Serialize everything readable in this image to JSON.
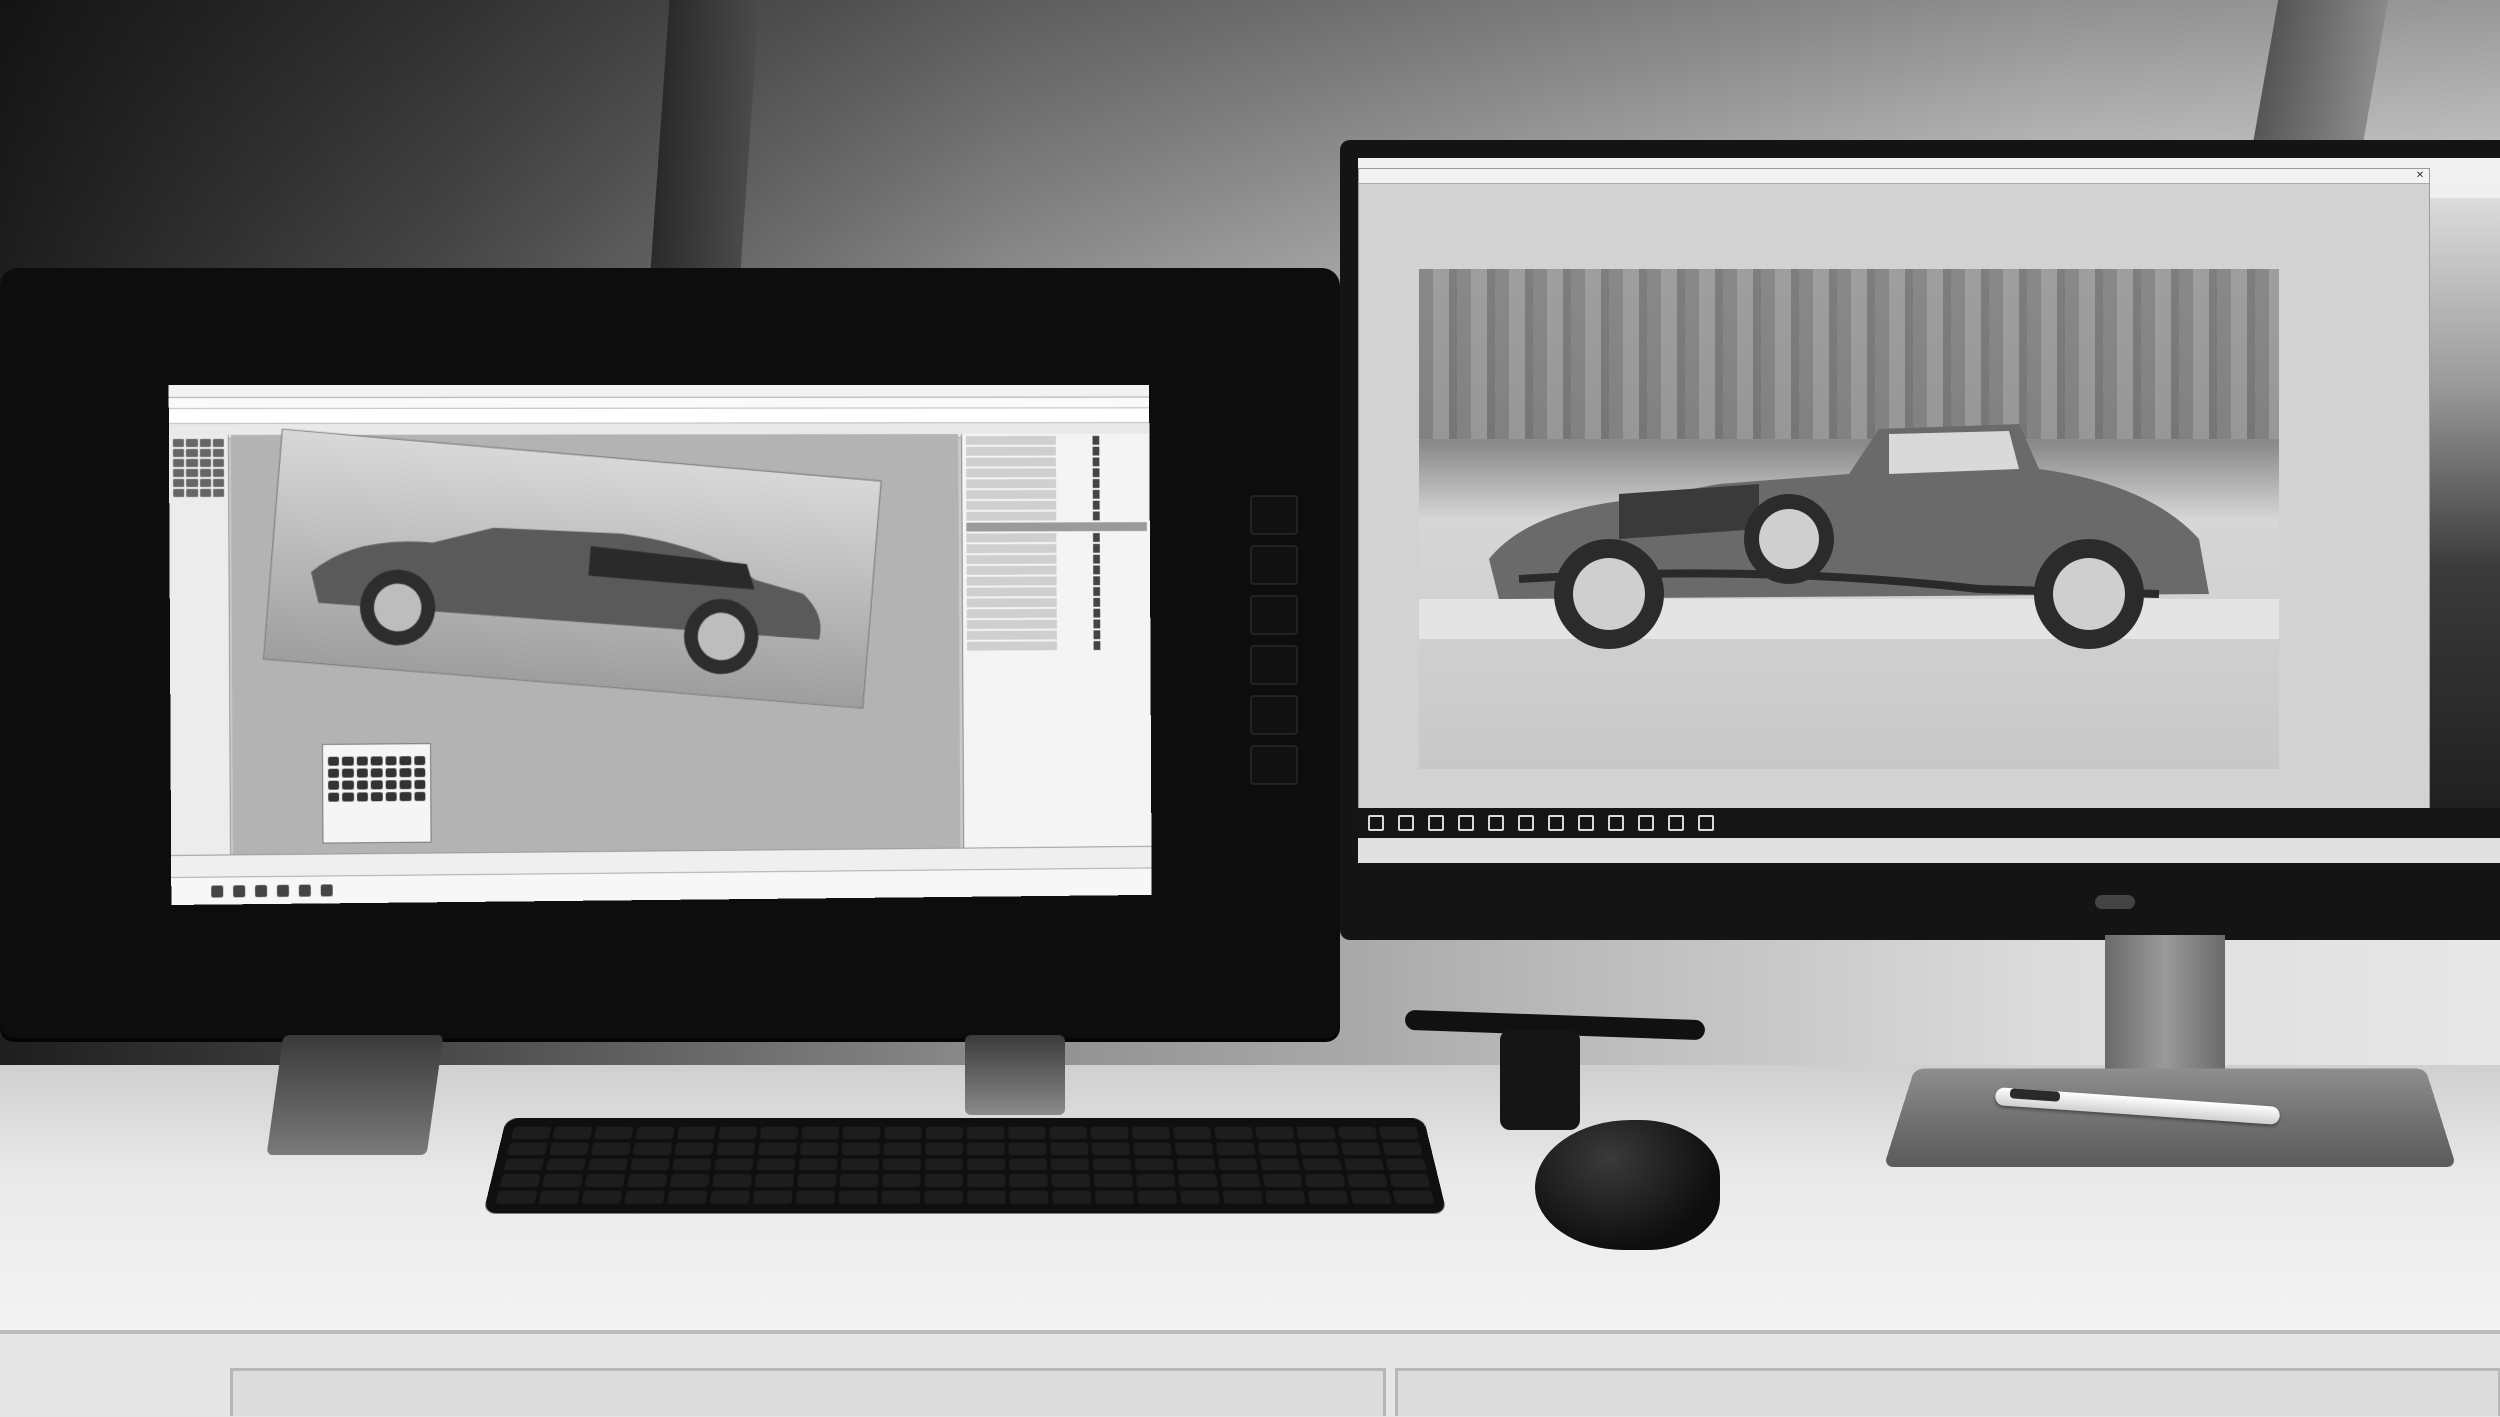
{
  "scene": {
    "palette": {
      "wall": "#b9b9b9",
      "desk": "#f0f0f0",
      "device_body": "#0d0d0d",
      "screen": "#d2d2d2"
    }
  },
  "objects": [
    {
      "name": "pen-display-tablet",
      "icon": "pen-display-icon"
    },
    {
      "name": "cad-application",
      "icon": "window-icon"
    },
    {
      "name": "external-monitor",
      "icon": "monitor-icon"
    },
    {
      "name": "image-viewer-window",
      "icon": "image-icon"
    },
    {
      "name": "keyboard",
      "icon": "keyboard-icon"
    },
    {
      "name": "mouse",
      "icon": "mouse-icon"
    },
    {
      "name": "stylus",
      "icon": "stylus-icon"
    },
    {
      "name": "pen",
      "icon": "pen-icon"
    }
  ]
}
